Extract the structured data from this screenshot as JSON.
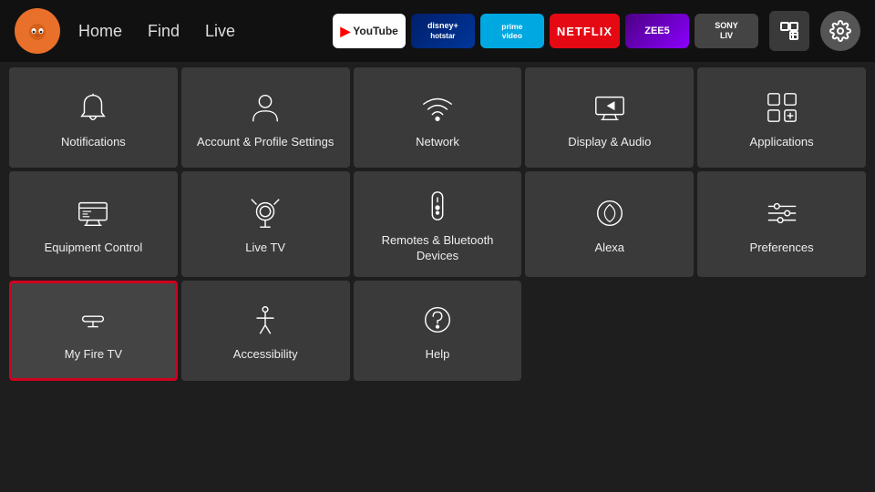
{
  "topbar": {
    "nav": [
      "Home",
      "Find",
      "Live"
    ],
    "apps": [
      {
        "label": "▶ YouTube",
        "class": "app-youtube",
        "name": "youtube-app"
      },
      {
        "label": "disney+ hotstar",
        "class": "app-disney",
        "name": "disney-app"
      },
      {
        "label": "prime video",
        "class": "app-prime",
        "name": "prime-app"
      },
      {
        "label": "NETFLIX",
        "class": "app-netflix",
        "name": "netflix-app"
      },
      {
        "label": "ZEE5",
        "class": "app-zee5",
        "name": "zee5-app"
      },
      {
        "label": "SONY LIV",
        "class": "app-sony",
        "name": "sony-app"
      }
    ]
  },
  "settings": {
    "tiles_row1": [
      {
        "id": "notifications",
        "label": "Notifications",
        "icon": "bell"
      },
      {
        "id": "account",
        "label": "Account & Profile Settings",
        "icon": "person"
      },
      {
        "id": "network",
        "label": "Network",
        "icon": "wifi"
      },
      {
        "id": "display",
        "label": "Display & Audio",
        "icon": "display"
      },
      {
        "id": "applications",
        "label": "Applications",
        "icon": "apps"
      }
    ],
    "tiles_row2": [
      {
        "id": "equipment",
        "label": "Equipment Control",
        "icon": "tv"
      },
      {
        "id": "livetv",
        "label": "Live TV",
        "icon": "antenna"
      },
      {
        "id": "remotes",
        "label": "Remotes & Bluetooth Devices",
        "icon": "remote"
      },
      {
        "id": "alexa",
        "label": "Alexa",
        "icon": "alexa"
      },
      {
        "id": "preferences",
        "label": "Preferences",
        "icon": "sliders"
      }
    ],
    "tiles_row3": [
      {
        "id": "myfiretv",
        "label": "My Fire TV",
        "icon": "firetv",
        "selected": true
      },
      {
        "id": "accessibility",
        "label": "Accessibility",
        "icon": "accessibility"
      },
      {
        "id": "help",
        "label": "Help",
        "icon": "help"
      }
    ]
  }
}
